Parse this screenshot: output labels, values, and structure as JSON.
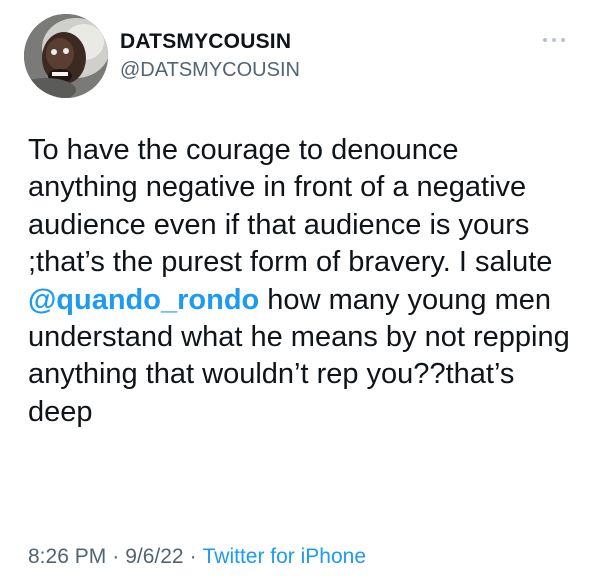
{
  "author": {
    "display_name": "DATSMYCOUSIN",
    "handle": "@DATSMYCOUSIN"
  },
  "tweet": {
    "text_part1": "To have the courage to denounce anything negative in front of a negative audience even if that audience is yours ;that’s the purest form of bravery. I salute ",
    "mention": "@quando_rondo",
    "text_part2": " how many young men understand what he means by not repping anything that wouldn’t rep you??that’s deep"
  },
  "meta": {
    "time": "8:26 PM",
    "separator": "·",
    "date": "9/6/22",
    "source": "Twitter for iPhone"
  },
  "icons": {
    "more": "more-dots-icon",
    "avatar": "profile-photo"
  },
  "colors": {
    "link": "#1d9bf0",
    "secondary_text": "#536471",
    "primary_text": "#0f1419"
  }
}
